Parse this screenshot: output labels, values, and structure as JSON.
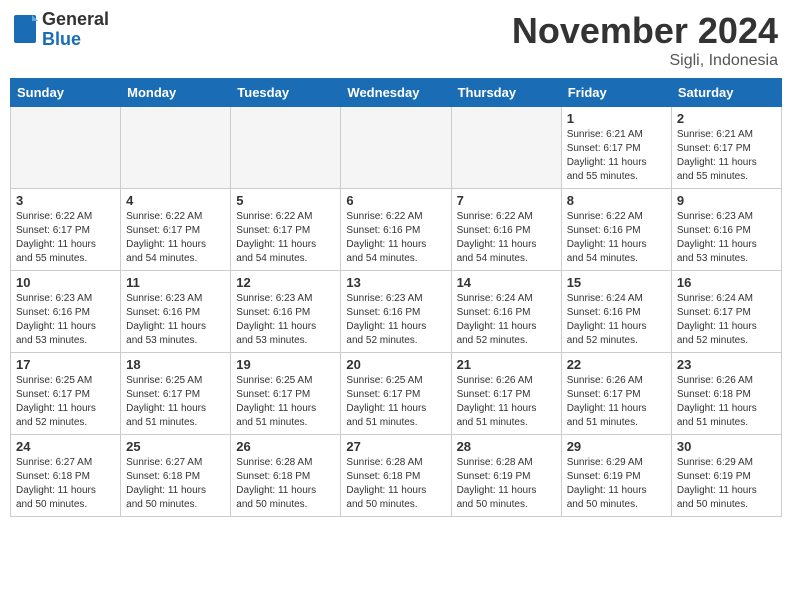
{
  "header": {
    "logo_general": "General",
    "logo_blue": "Blue",
    "month_title": "November 2024",
    "location": "Sigli, Indonesia"
  },
  "days_of_week": [
    "Sunday",
    "Monday",
    "Tuesday",
    "Wednesday",
    "Thursday",
    "Friday",
    "Saturday"
  ],
  "weeks": [
    [
      {
        "day": "",
        "empty": true
      },
      {
        "day": "",
        "empty": true
      },
      {
        "day": "",
        "empty": true
      },
      {
        "day": "",
        "empty": true
      },
      {
        "day": "",
        "empty": true
      },
      {
        "day": "1",
        "sunrise": "Sunrise: 6:21 AM",
        "sunset": "Sunset: 6:17 PM",
        "daylight": "Daylight: 11 hours and 55 minutes."
      },
      {
        "day": "2",
        "sunrise": "Sunrise: 6:21 AM",
        "sunset": "Sunset: 6:17 PM",
        "daylight": "Daylight: 11 hours and 55 minutes."
      }
    ],
    [
      {
        "day": "3",
        "sunrise": "Sunrise: 6:22 AM",
        "sunset": "Sunset: 6:17 PM",
        "daylight": "Daylight: 11 hours and 55 minutes."
      },
      {
        "day": "4",
        "sunrise": "Sunrise: 6:22 AM",
        "sunset": "Sunset: 6:17 PM",
        "daylight": "Daylight: 11 hours and 54 minutes."
      },
      {
        "day": "5",
        "sunrise": "Sunrise: 6:22 AM",
        "sunset": "Sunset: 6:17 PM",
        "daylight": "Daylight: 11 hours and 54 minutes."
      },
      {
        "day": "6",
        "sunrise": "Sunrise: 6:22 AM",
        "sunset": "Sunset: 6:16 PM",
        "daylight": "Daylight: 11 hours and 54 minutes."
      },
      {
        "day": "7",
        "sunrise": "Sunrise: 6:22 AM",
        "sunset": "Sunset: 6:16 PM",
        "daylight": "Daylight: 11 hours and 54 minutes."
      },
      {
        "day": "8",
        "sunrise": "Sunrise: 6:22 AM",
        "sunset": "Sunset: 6:16 PM",
        "daylight": "Daylight: 11 hours and 54 minutes."
      },
      {
        "day": "9",
        "sunrise": "Sunrise: 6:23 AM",
        "sunset": "Sunset: 6:16 PM",
        "daylight": "Daylight: 11 hours and 53 minutes."
      }
    ],
    [
      {
        "day": "10",
        "sunrise": "Sunrise: 6:23 AM",
        "sunset": "Sunset: 6:16 PM",
        "daylight": "Daylight: 11 hours and 53 minutes."
      },
      {
        "day": "11",
        "sunrise": "Sunrise: 6:23 AM",
        "sunset": "Sunset: 6:16 PM",
        "daylight": "Daylight: 11 hours and 53 minutes."
      },
      {
        "day": "12",
        "sunrise": "Sunrise: 6:23 AM",
        "sunset": "Sunset: 6:16 PM",
        "daylight": "Daylight: 11 hours and 53 minutes."
      },
      {
        "day": "13",
        "sunrise": "Sunrise: 6:23 AM",
        "sunset": "Sunset: 6:16 PM",
        "daylight": "Daylight: 11 hours and 52 minutes."
      },
      {
        "day": "14",
        "sunrise": "Sunrise: 6:24 AM",
        "sunset": "Sunset: 6:16 PM",
        "daylight": "Daylight: 11 hours and 52 minutes."
      },
      {
        "day": "15",
        "sunrise": "Sunrise: 6:24 AM",
        "sunset": "Sunset: 6:16 PM",
        "daylight": "Daylight: 11 hours and 52 minutes."
      },
      {
        "day": "16",
        "sunrise": "Sunrise: 6:24 AM",
        "sunset": "Sunset: 6:17 PM",
        "daylight": "Daylight: 11 hours and 52 minutes."
      }
    ],
    [
      {
        "day": "17",
        "sunrise": "Sunrise: 6:25 AM",
        "sunset": "Sunset: 6:17 PM",
        "daylight": "Daylight: 11 hours and 52 minutes."
      },
      {
        "day": "18",
        "sunrise": "Sunrise: 6:25 AM",
        "sunset": "Sunset: 6:17 PM",
        "daylight": "Daylight: 11 hours and 51 minutes."
      },
      {
        "day": "19",
        "sunrise": "Sunrise: 6:25 AM",
        "sunset": "Sunset: 6:17 PM",
        "daylight": "Daylight: 11 hours and 51 minutes."
      },
      {
        "day": "20",
        "sunrise": "Sunrise: 6:25 AM",
        "sunset": "Sunset: 6:17 PM",
        "daylight": "Daylight: 11 hours and 51 minutes."
      },
      {
        "day": "21",
        "sunrise": "Sunrise: 6:26 AM",
        "sunset": "Sunset: 6:17 PM",
        "daylight": "Daylight: 11 hours and 51 minutes."
      },
      {
        "day": "22",
        "sunrise": "Sunrise: 6:26 AM",
        "sunset": "Sunset: 6:17 PM",
        "daylight": "Daylight: 11 hours and 51 minutes."
      },
      {
        "day": "23",
        "sunrise": "Sunrise: 6:26 AM",
        "sunset": "Sunset: 6:18 PM",
        "daylight": "Daylight: 11 hours and 51 minutes."
      }
    ],
    [
      {
        "day": "24",
        "sunrise": "Sunrise: 6:27 AM",
        "sunset": "Sunset: 6:18 PM",
        "daylight": "Daylight: 11 hours and 50 minutes."
      },
      {
        "day": "25",
        "sunrise": "Sunrise: 6:27 AM",
        "sunset": "Sunset: 6:18 PM",
        "daylight": "Daylight: 11 hours and 50 minutes."
      },
      {
        "day": "26",
        "sunrise": "Sunrise: 6:28 AM",
        "sunset": "Sunset: 6:18 PM",
        "daylight": "Daylight: 11 hours and 50 minutes."
      },
      {
        "day": "27",
        "sunrise": "Sunrise: 6:28 AM",
        "sunset": "Sunset: 6:18 PM",
        "daylight": "Daylight: 11 hours and 50 minutes."
      },
      {
        "day": "28",
        "sunrise": "Sunrise: 6:28 AM",
        "sunset": "Sunset: 6:19 PM",
        "daylight": "Daylight: 11 hours and 50 minutes."
      },
      {
        "day": "29",
        "sunrise": "Sunrise: 6:29 AM",
        "sunset": "Sunset: 6:19 PM",
        "daylight": "Daylight: 11 hours and 50 minutes."
      },
      {
        "day": "30",
        "sunrise": "Sunrise: 6:29 AM",
        "sunset": "Sunset: 6:19 PM",
        "daylight": "Daylight: 11 hours and 50 minutes."
      }
    ]
  ]
}
